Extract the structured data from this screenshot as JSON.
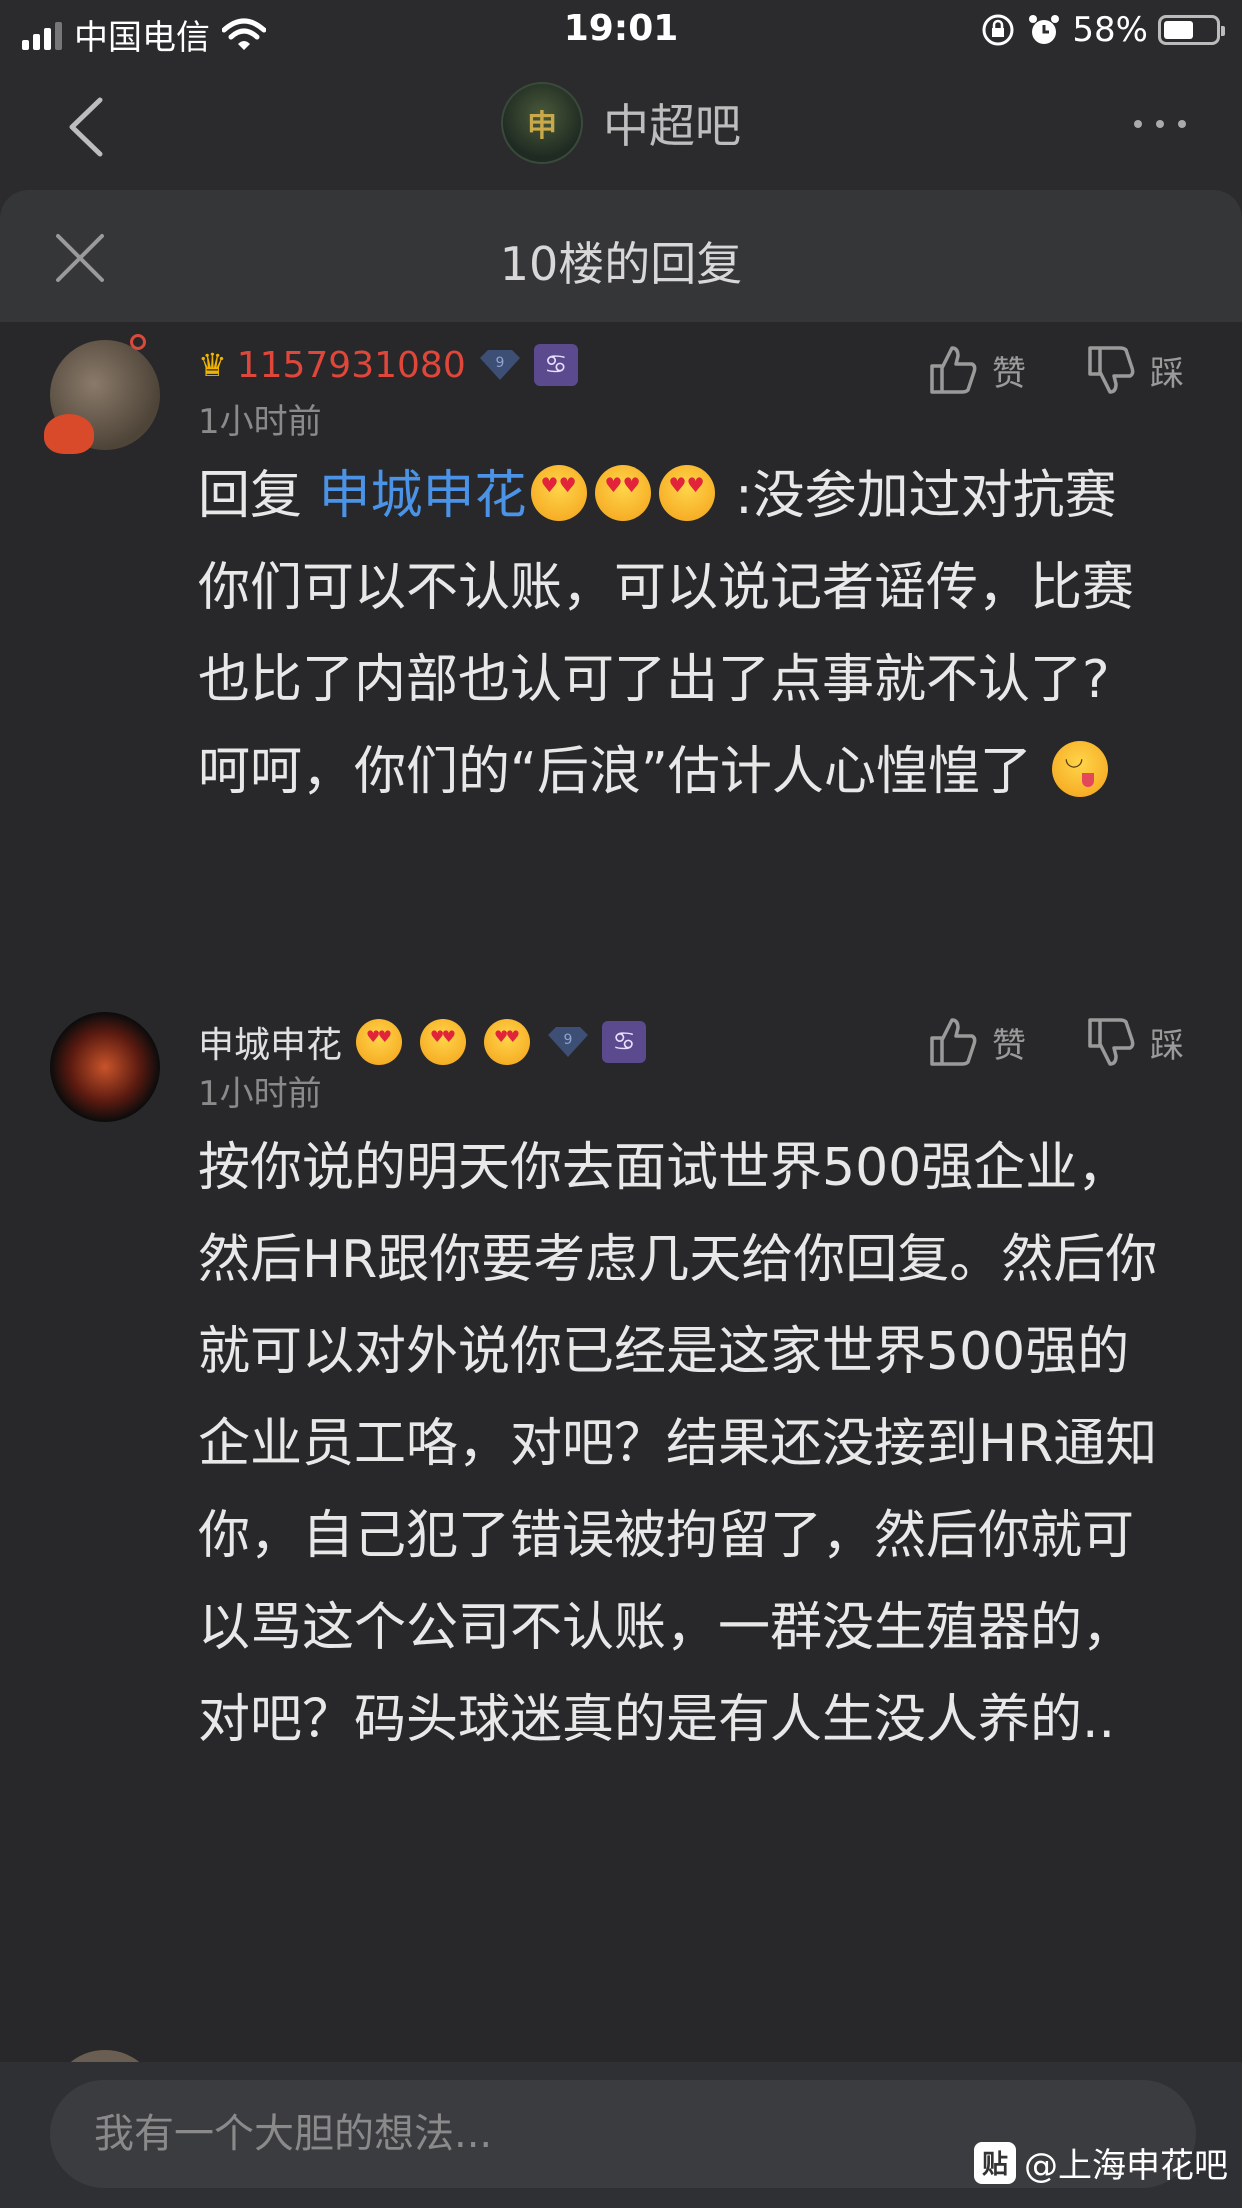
{
  "status_bar": {
    "carrier": "中国电信",
    "time": "19:01",
    "battery": "58%",
    "battery_level": 0.58
  },
  "nav": {
    "forum_logo_text": "申",
    "forum_name": "中超吧"
  },
  "panel": {
    "title": "10楼的回复"
  },
  "replies": [
    {
      "username": "1157931080",
      "level": "9",
      "zodiac": "♋",
      "time": "1小时前",
      "like_label": "赞",
      "dislike_label": "踩",
      "reply_prefix": "回复 ",
      "mention": "申城申花",
      "text_after_mention": " :没参加过对抗赛你们可以不认账，可以说记者谣传，比赛也比了内部也认可了出了点事就不认了?呵呵，你们的“后浪”估计人心惶惶了 "
    },
    {
      "username": "申城申花",
      "level": "9",
      "zodiac": "♋",
      "time": "1小时前",
      "like_label": "赞",
      "dislike_label": "踩",
      "text": "按你说的明天你去面试世界500强企业，然后HR跟你要考虑几天给你回复。然后你就可以对外说你已经是这家世界500强的企业员工咯，对吧？结果还没接到HR通知你，自己犯了错误被拘留了，然后你就可以骂这个公司不认账，一群没生殖器的，对吧？码头球迷真的是有人生没人养的.."
    }
  ],
  "bottom": {
    "input_placeholder": "我有一个大胆的想法...",
    "watermark_logo": "贴",
    "watermark": "@上海申花吧"
  }
}
